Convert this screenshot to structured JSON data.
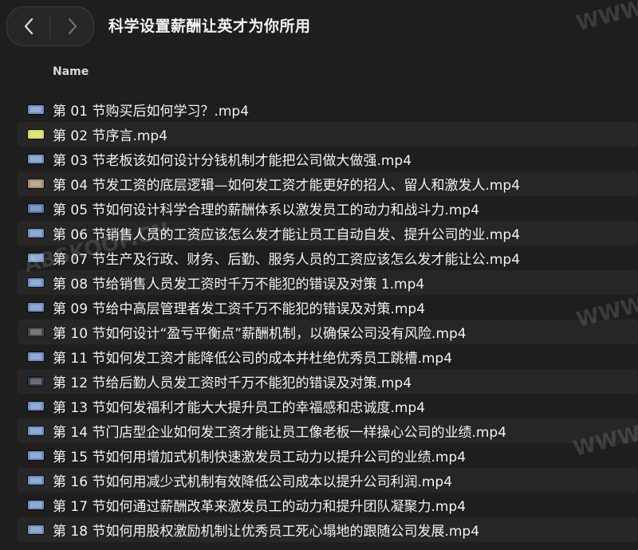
{
  "window": {
    "title": "科学设置薪酬让英才为你所用"
  },
  "toolbar": {
    "back_icon": "chevron-left-icon",
    "forward_icon": "chevron-right-icon"
  },
  "columns": {
    "name_label": "Name"
  },
  "files": [
    {
      "name": "第 01 节购买后如何学习？.mp4",
      "icon_color": "#6d8fc4"
    },
    {
      "name": "第 02 节序言.mp4",
      "icon_color": "#d6d860"
    },
    {
      "name": "第 03 节老板该如何设计分钱机制才能把公司做大做强.mp4",
      "icon_color": "#6d8fc4"
    },
    {
      "name": "第 04 节发工资的底层逻辑—如何发工资才能更好的招人、留人和激发人.mp4",
      "icon_color": "#a08f72"
    },
    {
      "name": "第 05 节如何设计科学合理的薪酬体系以激发员工的动力和战斗力.mp4",
      "icon_color": "#5a78b0"
    },
    {
      "name": "第 06 节销售人员的工资应该怎么发才能让员工自动自发、提升公司的业.mp4",
      "icon_color": "#6d8fc4"
    },
    {
      "name": "第 07 节生产及行政、财务、后勤、服务人员的工资应该怎么发才能让公.mp4",
      "icon_color": "#6d8fc4"
    },
    {
      "name": "第 08 节给销售人员发工资时千万不能犯的错误及对策 1.mp4",
      "icon_color": "#6d8fc4"
    },
    {
      "name": "第 09 节给中高层管理者发工资千万不能犯的错误及对策.mp4",
      "icon_color": "#6d8fc4"
    },
    {
      "name": "第 10 节如何设计“盈亏平衡点”薪酬机制，以确保公司没有风险.mp4",
      "icon_color": "#4a4a4a"
    },
    {
      "name": "第 11 节如何发工资才能降低公司的成本并杜绝优秀员工跳槽.mp4",
      "icon_color": "#6d8fc4"
    },
    {
      "name": "第 12 节给后勤人员发工资时千万不能犯的错误及对策.mp4",
      "icon_color": "#333c48"
    },
    {
      "name": "第 13 节如何发福利才能大大提升员工的幸福感和忠诚度.mp4",
      "icon_color": "#6d8fc4"
    },
    {
      "name": "第 14 节门店型企业如何发工资才能让员工像老板一样操心公司的业绩.mp4",
      "icon_color": "#6d8fc4"
    },
    {
      "name": "第 15 节如何用增加式机制快速激发员工动力以提升公司的业绩.mp4",
      "icon_color": "#6d8fc4"
    },
    {
      "name": "第 16 节如何用减少式机制有效降低公司成本以提升公司利润.mp4",
      "icon_color": "#6d8fc4"
    },
    {
      "name": "第 17 节如何通过薪酬改革来激发员工的动力和提升团队凝聚力.mp4",
      "icon_color": "#6d8fc4"
    },
    {
      "name": "第 18 节如何用股权激励机制让优秀员工死心塌地的跟随公司发展.mp4",
      "icon_color": "#6d8fc4"
    }
  ],
  "watermarks": [
    {
      "text": "WWW."
    },
    {
      "text": "WWW."
    },
    {
      "text": "WWW."
    },
    {
      "text": "ABSKOOP.CN"
    }
  ]
}
